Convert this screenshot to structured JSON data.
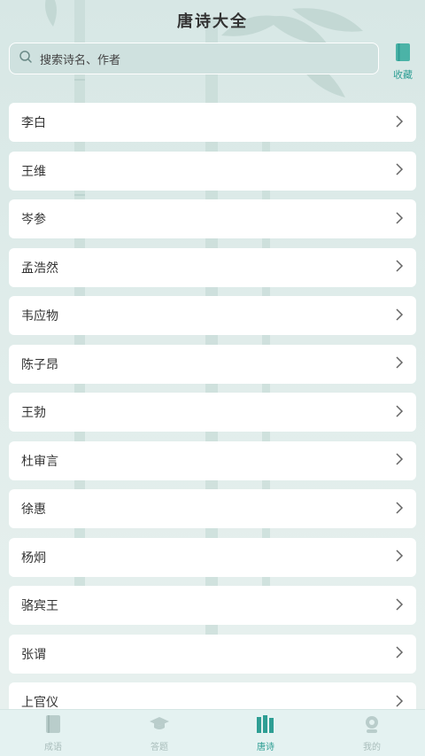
{
  "header": {
    "title": "唐诗大全"
  },
  "search": {
    "placeholder": "搜索诗名、作者"
  },
  "favorite": {
    "label": "收藏",
    "icon": "bookmark-icon"
  },
  "authors": [
    {
      "name": "李白"
    },
    {
      "name": "王维"
    },
    {
      "name": "岑参"
    },
    {
      "name": "孟浩然"
    },
    {
      "name": "韦应物"
    },
    {
      "name": "陈子昂"
    },
    {
      "name": "王勃"
    },
    {
      "name": "杜审言"
    },
    {
      "name": "徐惠"
    },
    {
      "name": "杨炯"
    },
    {
      "name": "骆宾王"
    },
    {
      "name": "张谓"
    },
    {
      "name": "上官仪"
    }
  ],
  "tabs": [
    {
      "label": "成语",
      "icon": "book-icon",
      "active": false
    },
    {
      "label": "答题",
      "icon": "graduation-cap-icon",
      "active": false
    },
    {
      "label": "唐诗",
      "icon": "books-icon",
      "active": true
    },
    {
      "label": "我的",
      "icon": "user-icon",
      "active": false
    }
  ],
  "colors": {
    "accent": "#2e9e94",
    "inactive": "#a9bdbb",
    "background": "#dfecea"
  }
}
